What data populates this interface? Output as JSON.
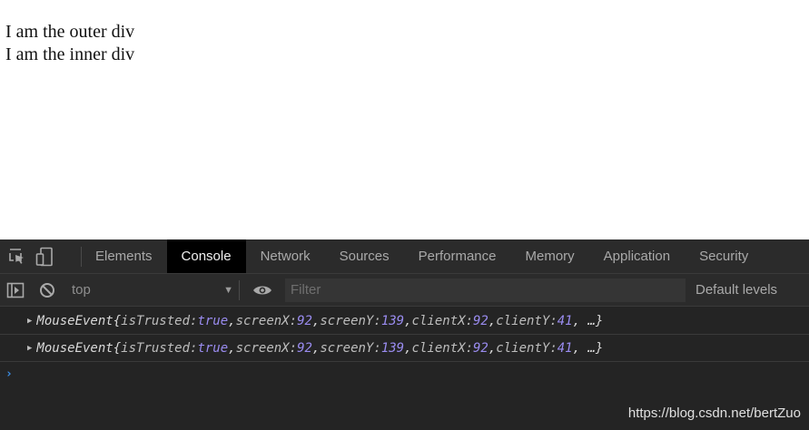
{
  "page": {
    "lines": [
      "I am the outer div",
      "I am the inner div"
    ]
  },
  "devtools": {
    "tabs": [
      {
        "label": "Elements",
        "active": false
      },
      {
        "label": "Console",
        "active": true
      },
      {
        "label": "Network",
        "active": false
      },
      {
        "label": "Sources",
        "active": false
      },
      {
        "label": "Performance",
        "active": false
      },
      {
        "label": "Memory",
        "active": false
      },
      {
        "label": "Application",
        "active": false
      },
      {
        "label": "Security",
        "active": false
      }
    ],
    "toolbar": {
      "context": "top",
      "filter_placeholder": "Filter",
      "levels": "Default levels"
    },
    "messages": [
      {
        "type": "MouseEvent",
        "open": " {",
        "fields": [
          {
            "key": "isTrusted",
            "value": "true",
            "kind": "bool"
          },
          {
            "key": "screenX",
            "value": "92",
            "kind": "num"
          },
          {
            "key": "screenY",
            "value": "139",
            "kind": "num"
          },
          {
            "key": "clientX",
            "value": "92",
            "kind": "num"
          },
          {
            "key": "clientY",
            "value": "41",
            "kind": "num"
          }
        ],
        "close": ", …}"
      },
      {
        "type": "MouseEvent",
        "open": " {",
        "fields": [
          {
            "key": "isTrusted",
            "value": "true",
            "kind": "bool"
          },
          {
            "key": "screenX",
            "value": "92",
            "kind": "num"
          },
          {
            "key": "screenY",
            "value": "139",
            "kind": "num"
          },
          {
            "key": "clientX",
            "value": "92",
            "kind": "num"
          },
          {
            "key": "clientY",
            "value": "41",
            "kind": "num"
          }
        ],
        "close": ", …}"
      }
    ],
    "prompt_symbol": "›"
  },
  "watermark": "https://blog.csdn.net/bertZuo",
  "colors": {
    "devtools_bg": "#242424",
    "active_tab_bg": "#000000",
    "value_purple": "#9a8cf0",
    "prompt_blue": "#3b8fe8"
  },
  "icons": [
    "inspect-element-icon",
    "device-toolbar-icon",
    "sidebar-toggle-icon",
    "clear-console-icon",
    "eye-icon"
  ]
}
